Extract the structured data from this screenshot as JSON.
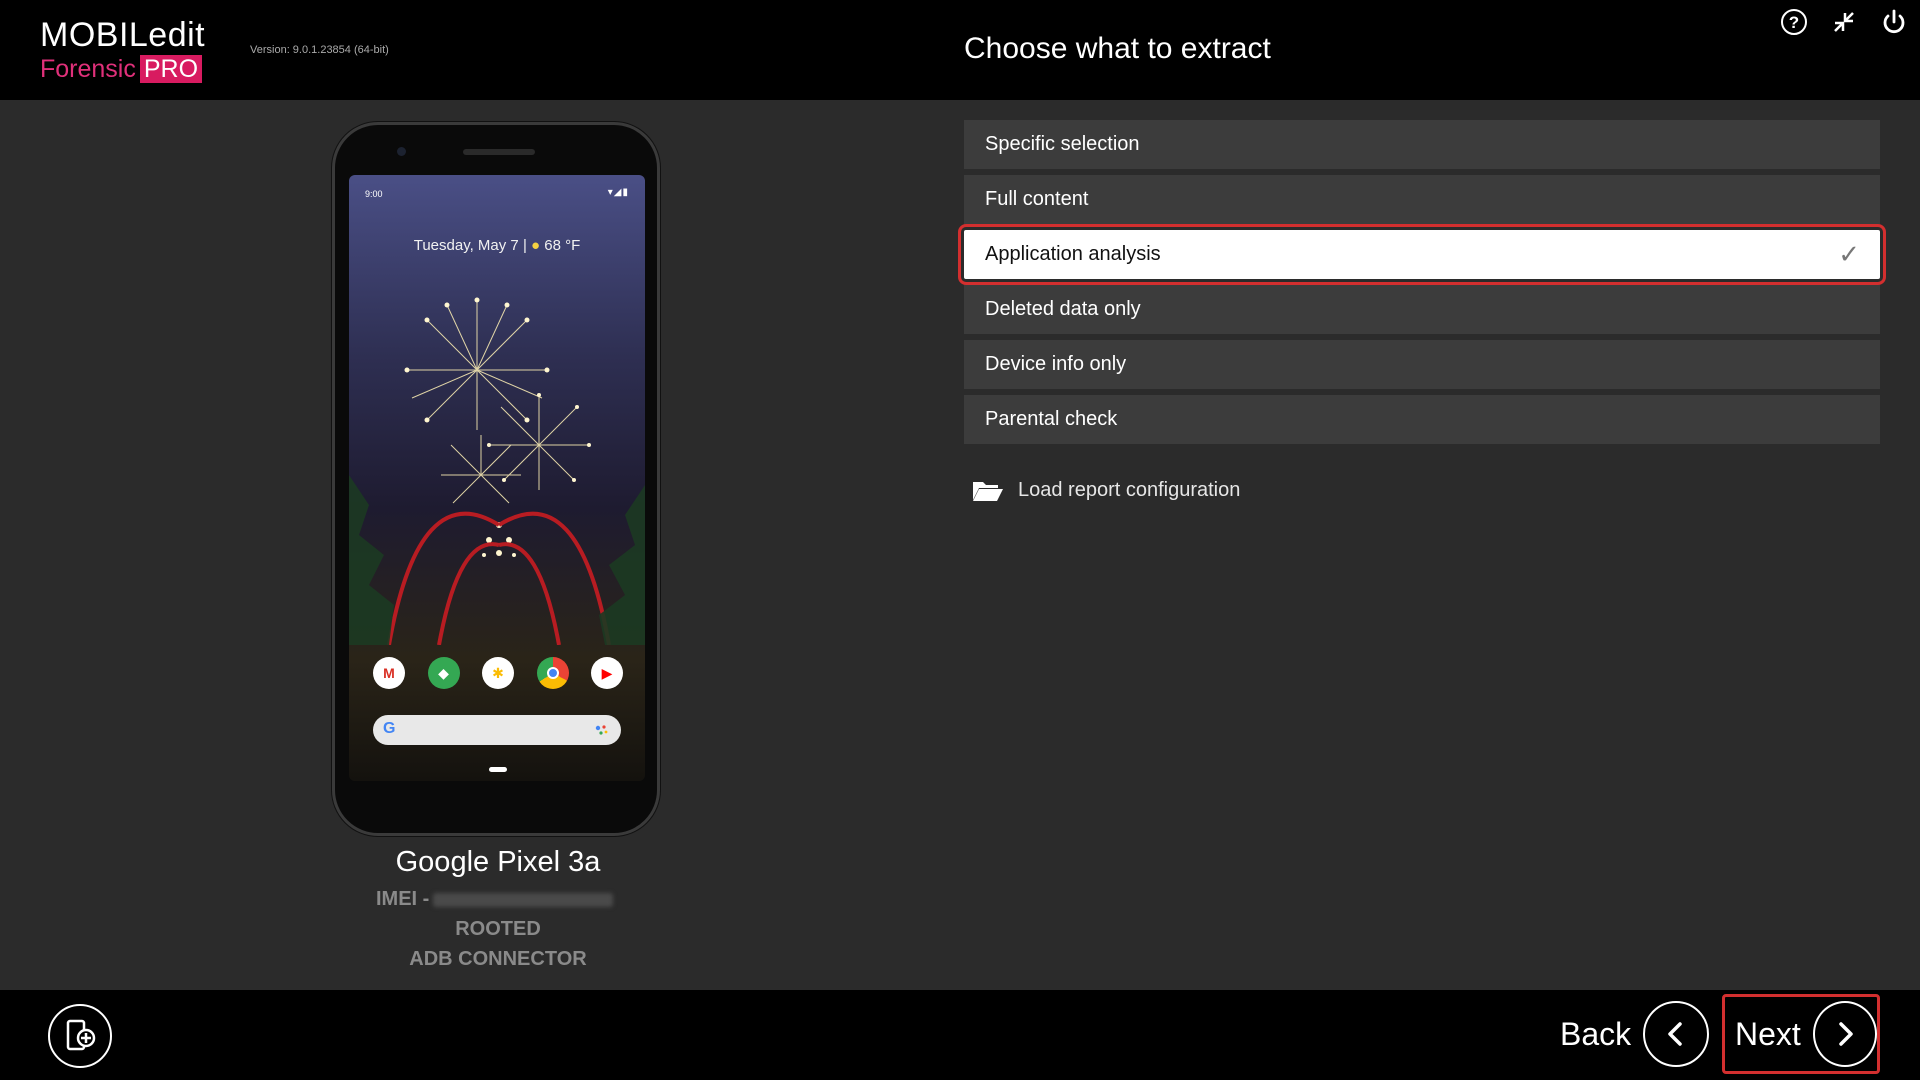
{
  "header": {
    "logo_line1": "MOBILedit",
    "logo_line2": "Forensic",
    "logo_badge": "PRO",
    "version": "Version: 9.0.1.23854 (64-bit)",
    "title": "Choose what to extract",
    "icons": [
      "help-icon",
      "minimize-icon",
      "power-icon"
    ]
  },
  "device": {
    "screen": {
      "time": "9:00",
      "date": "Tuesday, May 7",
      "temp": "68 °F",
      "dock_apps": [
        "gmail-icon",
        "maps-icon",
        "photos-icon",
        "chrome-icon",
        "youtube-icon"
      ]
    },
    "name": "Google Pixel 3a",
    "imei_label": "IMEI -",
    "status": [
      "ROOTED",
      "ADB CONNECTOR"
    ]
  },
  "options": [
    {
      "label": "Specific selection",
      "selected": false
    },
    {
      "label": "Full content",
      "selected": false
    },
    {
      "label": "Application analysis",
      "selected": true
    },
    {
      "label": "Deleted data only",
      "selected": false
    },
    {
      "label": "Device info only",
      "selected": false
    },
    {
      "label": "Parental check",
      "selected": false
    }
  ],
  "check_mark": "✓",
  "load_config": "Load report configuration",
  "footer": {
    "back": "Back",
    "next": "Next"
  },
  "colors": {
    "accent": "#d81b60",
    "highlight_border": "#d32f2f",
    "panel": "#2b2b2b",
    "option_bg": "#3c3c3c"
  }
}
